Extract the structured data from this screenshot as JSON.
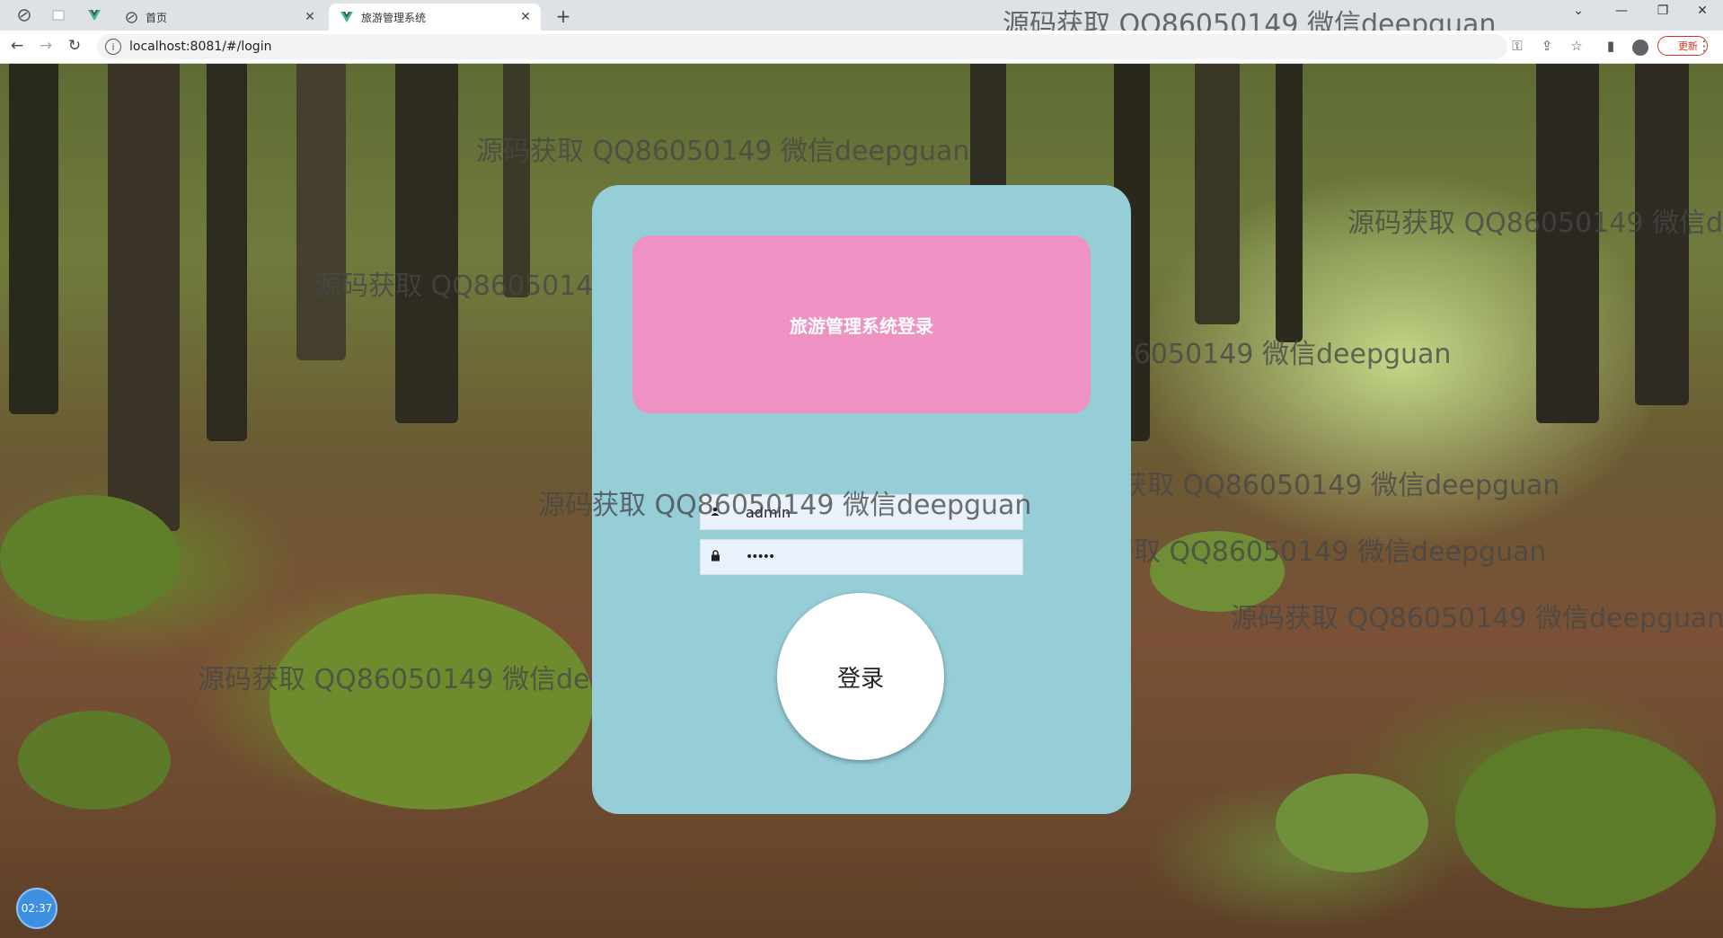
{
  "browser": {
    "tabs": [
      {
        "label": "首页",
        "active": false
      },
      {
        "label": "旅游管理系统",
        "active": true
      }
    ],
    "address": "localhost:8081/#/login",
    "update_label": "更新"
  },
  "login": {
    "title": "旅游管理系统登录",
    "username_value": "admin",
    "password_value": "•••••",
    "submit_label": "登录"
  },
  "watermark": "源码获取 QQ86050149 微信deepguan",
  "clock": "02:37",
  "colors": {
    "card": "#96ced8",
    "title_box": "#ee92c3",
    "button": "#ffffff"
  }
}
